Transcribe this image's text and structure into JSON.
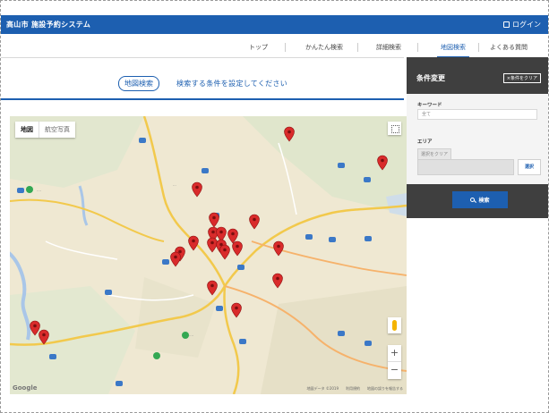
{
  "header": {
    "title": "高山市 施設予約システム",
    "login_label": "ログイン"
  },
  "nav": {
    "items": [
      {
        "label": "トップ",
        "active": false
      },
      {
        "label": "かんたん検索",
        "active": false
      },
      {
        "label": "詳細検索",
        "active": false
      },
      {
        "label": "地図検索",
        "active": true
      },
      {
        "label": "よくある質問",
        "active": false
      }
    ]
  },
  "search": {
    "tag": "地図検索",
    "prompt": "検索する条件を設定してください"
  },
  "map": {
    "type_options": [
      "地図",
      "航空写真"
    ],
    "selected_type": "地図",
    "provider": "Google",
    "attribution": [
      "地図データ ©2019",
      "利用規約",
      "地図の誤りを報告する"
    ],
    "zoom_in": "+",
    "zoom_out": "−",
    "marker_color": "#d92b2b"
  },
  "panel": {
    "title": "条件変更",
    "clear_label": "×条件をクリア",
    "keyword_label": "キーワード",
    "keyword_value": "全て",
    "area_label": "エリア",
    "area_chip": "選択をクリア",
    "select_label": "選択",
    "search_label": "検索"
  },
  "colors": {
    "primary": "#1d5fb0",
    "panel_dark": "#3f3f3f",
    "map_bg": "#efe8d2"
  }
}
